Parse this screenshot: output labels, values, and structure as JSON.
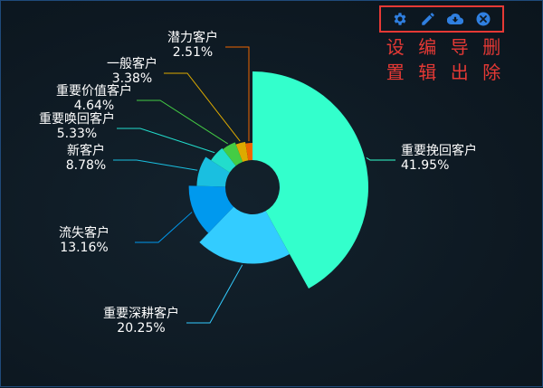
{
  "chart_data": {
    "type": "pie",
    "variant": "rose",
    "slices": [
      {
        "label": "重要挽回客户",
        "value": 41.95,
        "value_text": "41.95%",
        "color": "#33ffcc"
      },
      {
        "label": "重要深耕客户",
        "value": 20.25,
        "value_text": "20.25%",
        "color": "#33ccff"
      },
      {
        "label": "流失客户",
        "value": 13.16,
        "value_text": "13.16%",
        "color": "#0099ee"
      },
      {
        "label": "新客户",
        "value": 8.78,
        "value_text": "8.78%",
        "color": "#1abfe0"
      },
      {
        "label": "重要唤回客户",
        "value": 5.33,
        "value_text": "5.33%",
        "color": "#22ddcc"
      },
      {
        "label": "重要价值客户",
        "value": 4.64,
        "value_text": "4.64%",
        "color": "#44cc44"
      },
      {
        "label": "一般客户",
        "value": 3.38,
        "value_text": "3.38%",
        "color": "#ddaa00"
      },
      {
        "label": "潜力客户",
        "value": 2.51,
        "value_text": "2.51%",
        "color": "#ee6600"
      }
    ]
  },
  "toolbar": {
    "accent": "#e53935",
    "icon_color": "#2f7fe0",
    "tools": [
      {
        "name": "settings",
        "icon": "gear-icon",
        "label": "设置"
      },
      {
        "name": "edit",
        "icon": "pencil-icon",
        "label": "编辑"
      },
      {
        "name": "export",
        "icon": "cloud-download-icon",
        "label": "导出"
      },
      {
        "name": "delete",
        "icon": "close-circle-icon",
        "label": "删除"
      }
    ]
  }
}
